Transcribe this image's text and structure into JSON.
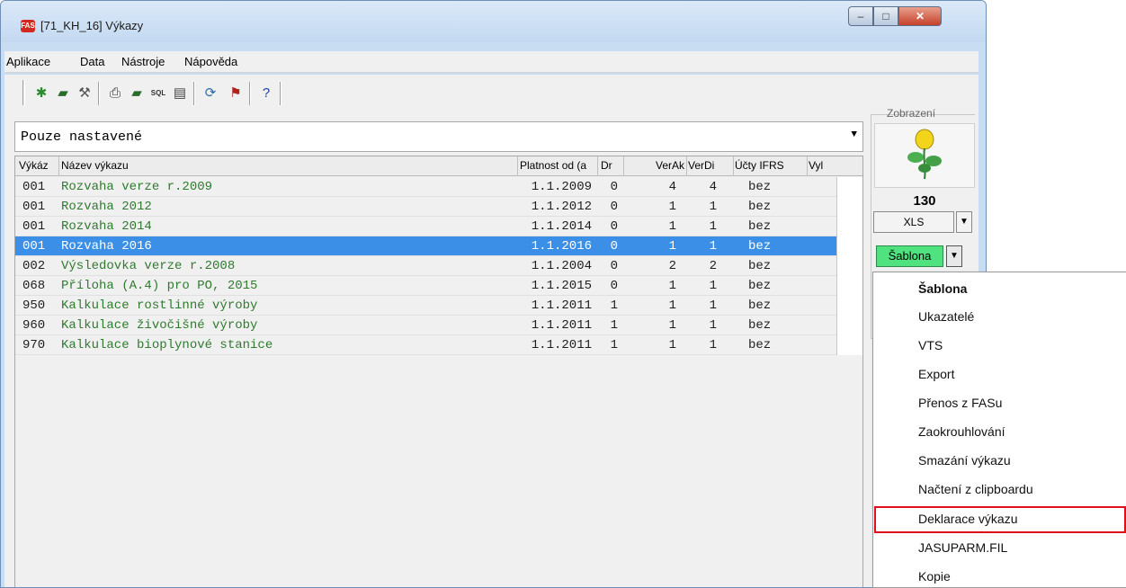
{
  "window": {
    "title": "[71_KH_16] Výkazy",
    "app_icon_text": "FAS",
    "min_glyph": "–",
    "max_glyph": "□",
    "close_glyph": "✕"
  },
  "menu": [
    "Aplikace",
    "Data",
    "Nástroje",
    "Nápověda"
  ],
  "toolbar": {
    "icons": [
      "new-icon",
      "open-icon",
      "tools-icon",
      "print-icon",
      "export-icon",
      "sql-icon",
      "report-icon",
      "refresh-icon",
      "exit-icon",
      "help-icon"
    ],
    "sql_label": "SQL"
  },
  "filter": {
    "value": "Pouze nastavené"
  },
  "grid": {
    "columns": [
      "Výkáz",
      "Název výkazu",
      "Platnost od (a",
      "Dr",
      "VerAk",
      "VerDi",
      "Účty IFRS",
      "Vyl"
    ],
    "rows": [
      {
        "code": "001",
        "name": "Rozvaha verze r.2009",
        "date": "1.1.2009",
        "dr": "0",
        "verak": "4",
        "verdi": "4",
        "ifrs": "bez"
      },
      {
        "code": "001",
        "name": "Rozvaha 2012",
        "date": "1.1.2012",
        "dr": "0",
        "verak": "1",
        "verdi": "1",
        "ifrs": "bez"
      },
      {
        "code": "001",
        "name": "Rozvaha 2014",
        "date": "1.1.2014",
        "dr": "0",
        "verak": "1",
        "verdi": "1",
        "ifrs": "bez"
      },
      {
        "code": "001",
        "name": "Rozvaha 2016",
        "date": "1.1.2016",
        "dr": "0",
        "verak": "1",
        "verdi": "1",
        "ifrs": "bez"
      },
      {
        "code": "002",
        "name": "Výsledovka verze r.2008",
        "date": "1.1.2004",
        "dr": "0",
        "verak": "2",
        "verdi": "2",
        "ifrs": "bez"
      },
      {
        "code": "068",
        "name": "Příloha (A.4) pro PO, 2015",
        "date": "1.1.2015",
        "dr": "0",
        "verak": "1",
        "verdi": "1",
        "ifrs": "bez"
      },
      {
        "code": "950",
        "name": "Kalkulace rostlinné výroby",
        "date": "1.1.2011",
        "dr": "1",
        "verak": "1",
        "verdi": "1",
        "ifrs": "bez"
      },
      {
        "code": "960",
        "name": "Kalkulace živočišné výroby",
        "date": "1.1.2011",
        "dr": "1",
        "verak": "1",
        "verdi": "1",
        "ifrs": "bez"
      },
      {
        "code": "970",
        "name": "Kalkulace bioplynové stanice",
        "date": "1.1.2011",
        "dr": "1",
        "verak": "1",
        "verdi": "1",
        "ifrs": "bez"
      }
    ],
    "selected_index": 3
  },
  "panel": {
    "label": "Zobrazení",
    "count": "130",
    "xls_label": "XLS",
    "sablona_label": "Šablona",
    "dropdown_glyph": "▼"
  },
  "popup_menu": {
    "items": [
      "Šablona",
      "Ukazatelé",
      "VTS",
      "Export",
      "Přenos z FASu",
      "Zaokrouhlování",
      "Smazání výkazu",
      "Načtení z clipboardu",
      "Deklarace výkazu",
      "JASUPARM.FIL",
      "Kopie"
    ],
    "bold_index": 0,
    "highlighted_index": 8
  }
}
